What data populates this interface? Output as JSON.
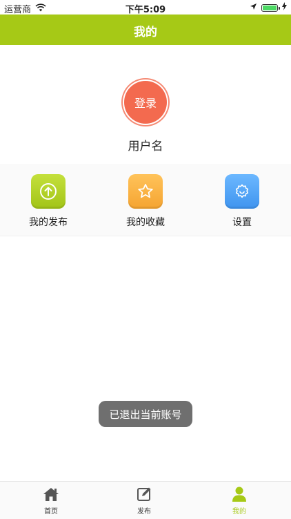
{
  "status_bar": {
    "carrier": "运营商",
    "time": "下午5:09"
  },
  "nav": {
    "title": "我的"
  },
  "profile": {
    "login_label": "登录",
    "username": "用户名"
  },
  "actions": [
    {
      "label": "我的发布",
      "icon": "upload-icon",
      "color": "#a6c916"
    },
    {
      "label": "我的收藏",
      "icon": "star-icon",
      "color": "#f7a93a"
    },
    {
      "label": "设置",
      "icon": "gear-icon",
      "color": "#4a9ff0"
    }
  ],
  "toast": {
    "message": "已退出当前账号"
  },
  "tabs": [
    {
      "label": "首页",
      "icon": "home-icon",
      "active": false
    },
    {
      "label": "发布",
      "icon": "edit-icon",
      "active": false
    },
    {
      "label": "我的",
      "icon": "user-icon",
      "active": true
    }
  ],
  "colors": {
    "accent": "#a6c916",
    "login": "#f36a4f",
    "toast": "#6f6f6f"
  }
}
